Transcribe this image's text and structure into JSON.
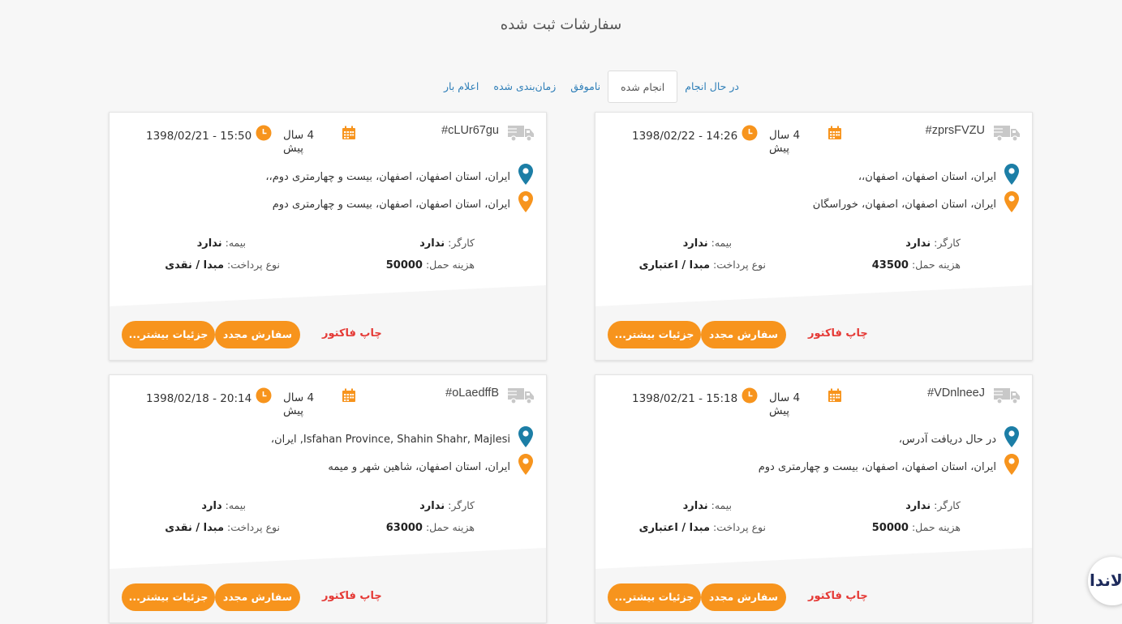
{
  "page_title": "سفارشات ثبت شده",
  "tabs": [
    {
      "label": "در حال انجام"
    },
    {
      "label": "انجام شده"
    },
    {
      "label": "ناموفق"
    },
    {
      "label": "زمان‌بندی شده"
    },
    {
      "label": "اعلام بار"
    }
  ],
  "active_tab": "انجام شده",
  "labels": {
    "worker": "کارگر:",
    "insurance": "بیمه:",
    "cost": "هزینه حمل:",
    "payment": "نوع پرداخت:",
    "print": "چاپ فاکتور",
    "reorder": "سفارش مجدد",
    "details": "جزئیات بیشتر..."
  },
  "colors": {
    "accent": "#f7941d",
    "print_link": "#e53935",
    "origin_pin": "#1c7ea6",
    "dest_pin": "#f7941d",
    "tab_link": "#2f7fb8"
  },
  "orders": [
    {
      "id": "#zprsFVZU",
      "ago": "4 سال پیش",
      "date": "1398/02/22 - 14:26",
      "origin": "ایران، استان اصفهان، اصفهان،،",
      "destination": "ایران، استان اصفهان، اصفهان، خوراسگان",
      "worker": "ندارد",
      "insurance": "ندارد",
      "cost": "43500",
      "payment": "مبدا / اعتباری"
    },
    {
      "id": "#cLUr67gu",
      "ago": "4 سال پیش",
      "date": "1398/02/21 - 15:50",
      "origin": "ایران، استان اصفهان، اصفهان، بیست و چهارمتری دوم،،",
      "destination": "ایران، استان اصفهان، اصفهان، بیست و چهارمتری دوم",
      "worker": "ندارد",
      "insurance": "ندارد",
      "cost": "50000",
      "payment": "مبدا / نقدی"
    },
    {
      "id": "#VDnlneeJ",
      "ago": "4 سال پیش",
      "date": "1398/02/21 - 15:18",
      "origin": "در حال دریافت آدرس،",
      "destination": "ایران، استان اصفهان، اصفهان، بیست و چهارمتری دوم",
      "worker": "ندارد",
      "insurance": "ندارد",
      "cost": "50000",
      "payment": "مبدا / اعتباری"
    },
    {
      "id": "#oLaedffB",
      "ago": "4 سال پیش",
      "date": "1398/02/18 - 20:14",
      "origin": "Isfahan Province, Shahin Shahr, Majlesi, ایران،",
      "destination": "ایران، استان اصفهان، شاهین شهر و میمه",
      "worker": "ندارد",
      "insurance": "دارد",
      "cost": "63000",
      "payment": "مبدا / نقدی"
    }
  ],
  "chat_widget": {
    "logo_text": "لاندا"
  }
}
